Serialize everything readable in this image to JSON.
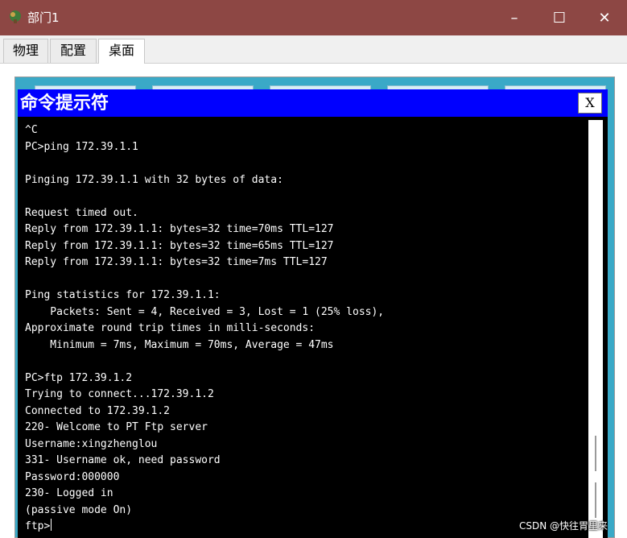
{
  "window": {
    "title": "部门1",
    "icon": "pc-device-icon",
    "controls": {
      "minimize": "–",
      "maximize": "☐",
      "close": "✕"
    }
  },
  "tabs": [
    {
      "label": "物理",
      "active": false
    },
    {
      "label": "配置",
      "active": false
    },
    {
      "label": "桌面",
      "active": true
    }
  ],
  "command_prompt": {
    "title": "命令提示符",
    "close_label": "X",
    "background": "#000000",
    "title_bar_color": "#0000ff",
    "lines": [
      "^C",
      "PC>ping 172.39.1.1",
      "",
      "Pinging 172.39.1.1 with 32 bytes of data:",
      "",
      "Request timed out.",
      "Reply from 172.39.1.1: bytes=32 time=70ms TTL=127",
      "Reply from 172.39.1.1: bytes=32 time=65ms TTL=127",
      "Reply from 172.39.1.1: bytes=32 time=7ms TTL=127",
      "",
      "Ping statistics for 172.39.1.1:",
      "    Packets: Sent = 4, Received = 3, Lost = 1 (25% loss),",
      "Approximate round trip times in milli-seconds:",
      "    Minimum = 7ms, Maximum = 70ms, Average = 47ms",
      "",
      "PC>ftp 172.39.1.2",
      "Trying to connect...172.39.1.2",
      "Connected to 172.39.1.2",
      "220- Welcome to PT Ftp server",
      "Username:xingzhenglou",
      "331- Username ok, need password",
      "Password:000000",
      "230- Logged in",
      "(passive mode On)"
    ],
    "prompt": "ftp>"
  },
  "watermark": "CSDN @快往胃里来"
}
